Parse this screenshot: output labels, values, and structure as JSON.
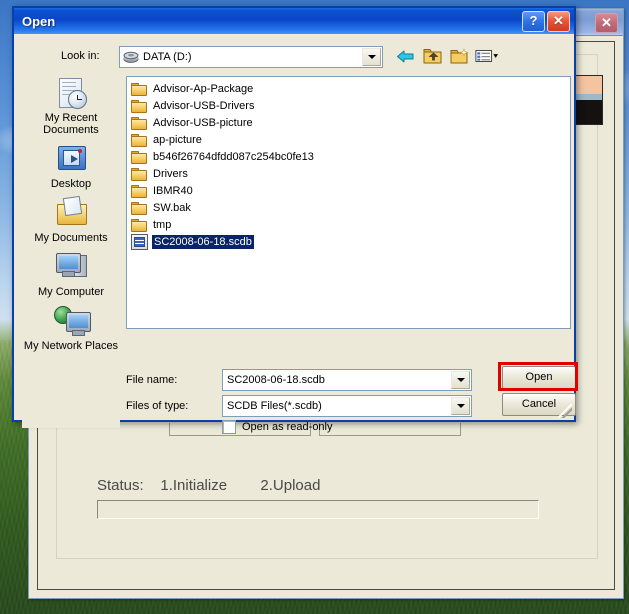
{
  "desktop": {
    "wallpaper_name": "bliss-wallpaper",
    "sky_color": "#5b93d6",
    "grass_color": "#3f7025"
  },
  "background_window": {
    "close_label": "✕",
    "status_text": "Status:    1.Initialize        2.Upload",
    "progress_value": "",
    "thumbnail_name": "photo-thumbnail"
  },
  "dialog": {
    "title": "Open",
    "help_label": "?",
    "close_label": "✕",
    "lookin": {
      "label": "Look in:",
      "value": "DATA (D:)",
      "icon": "drive-icon"
    },
    "toolbar": [
      {
        "name": "back-icon",
        "tooltip": "Back"
      },
      {
        "name": "up-one-level-icon",
        "tooltip": "Up One Level"
      },
      {
        "name": "create-new-folder-icon",
        "tooltip": "Create New Folder"
      },
      {
        "name": "views-icon",
        "tooltip": "Views"
      }
    ],
    "files": [
      {
        "name": "Advisor-Ap-Package",
        "type": "folder",
        "selected": false
      },
      {
        "name": "Advisor-USB-Drivers",
        "type": "folder",
        "selected": false
      },
      {
        "name": "Advisor-USB-picture",
        "type": "folder",
        "selected": false
      },
      {
        "name": "ap-picture",
        "type": "folder",
        "selected": false
      },
      {
        "name": "b546f26764dfdd087c254bc0fe13",
        "type": "folder",
        "selected": false
      },
      {
        "name": "Drivers",
        "type": "folder",
        "selected": false
      },
      {
        "name": "IBMR40",
        "type": "folder",
        "selected": false
      },
      {
        "name": "SW.bak",
        "type": "folder",
        "selected": false
      },
      {
        "name": "tmp",
        "type": "folder",
        "selected": false
      },
      {
        "name": "SC2008-06-18.scdb",
        "type": "file",
        "selected": true
      }
    ],
    "places": [
      {
        "label": "My Recent Documents",
        "icon": "recent-documents-icon"
      },
      {
        "label": "Desktop",
        "icon": "desktop-icon"
      },
      {
        "label": "My Documents",
        "icon": "my-documents-icon"
      },
      {
        "label": "My Computer",
        "icon": "my-computer-icon"
      },
      {
        "label": "My Network Places",
        "icon": "my-network-places-icon"
      }
    ],
    "filename": {
      "label": "File name:",
      "value": "SC2008-06-18.scdb"
    },
    "filetype": {
      "label": "Files of type:",
      "value": "SCDB Files(*.scdb)"
    },
    "readonly": {
      "label": "Open as read-only",
      "checked": false
    },
    "buttons": {
      "open": "Open",
      "cancel": "Cancel"
    },
    "highlight_color": "#e00000"
  }
}
